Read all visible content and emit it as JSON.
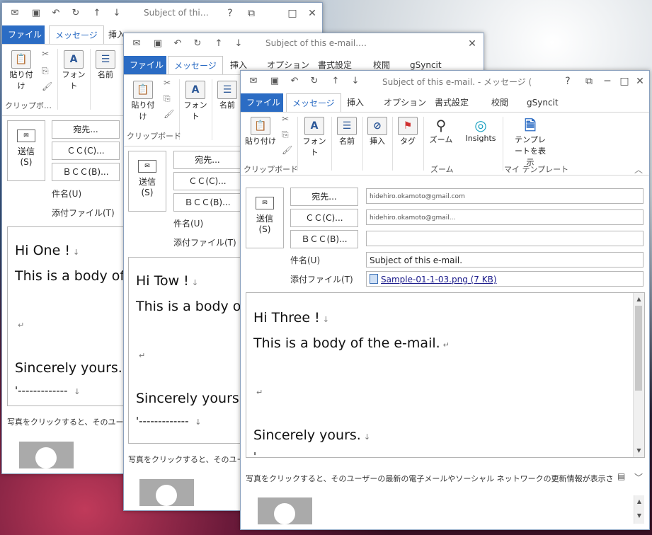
{
  "title_text": "Subject of this e-mail. - メッセージ (…",
  "title_short_1": "Subject of thi…",
  "title_short_2": "Subject of this e-mail.…",
  "tabs": {
    "file": "ファイル",
    "message": "メッセージ",
    "insert": "挿入",
    "options": "オプション",
    "format": "書式設定",
    "review": "校閲",
    "gsyncit": "gSyncit"
  },
  "ribbon": {
    "paste": "貼り付け",
    "font": "フォント",
    "names": "名前",
    "insert": "挿入",
    "tags": "タグ",
    "zoom": "ズーム",
    "insights": "Insights",
    "template": "テンプレートを表示",
    "group_clipboard": "クリップボード",
    "group_clipboard_short": "クリップボ…",
    "group_zoom": "ズーム",
    "group_template": "マイ テンプレート"
  },
  "compose": {
    "send": "送信",
    "send_key": "(S)",
    "to_btn": "宛先...",
    "cc_btn": "ＣＣ(C)...",
    "bcc_btn": "ＢＣＣ(B)...",
    "subject_label": "件名(U)",
    "attach_label": "添付ファイル(T)"
  },
  "mail3": {
    "to_value": "hidehiro.okamoto@gmail.com",
    "cc_value": "hidehiro.okamoto@gmail...",
    "subject": "Subject of this e-mail.",
    "attachment": "Sample-01-1-03.png (7 KB)",
    "greeting": "Hi Three !",
    "line1": "This is a body of the e-mail.",
    "closing": "Sincerely yours.",
    "dash": "'"
  },
  "mail2": {
    "greeting": "Hi Tow !",
    "line1": "This is a body o",
    "closing": "Sincerely yours",
    "dash": "'------------- "
  },
  "mail1": {
    "greeting": "Hi One !",
    "line1": "This is a body of",
    "closing": "Sincerely yours.",
    "dash": "'------------- "
  },
  "para_mark": "↵",
  "arrow_mark": "↓",
  "people_pane": "写真をクリックすると、そのユーザーの最新の電子メールやソーシャル ネットワークの更新情報が表示さ…",
  "people_pane_short1": "写真をクリックすると、そのユーザーの",
  "people_pane_short2": "写真をクリックすると、そのユーザ"
}
